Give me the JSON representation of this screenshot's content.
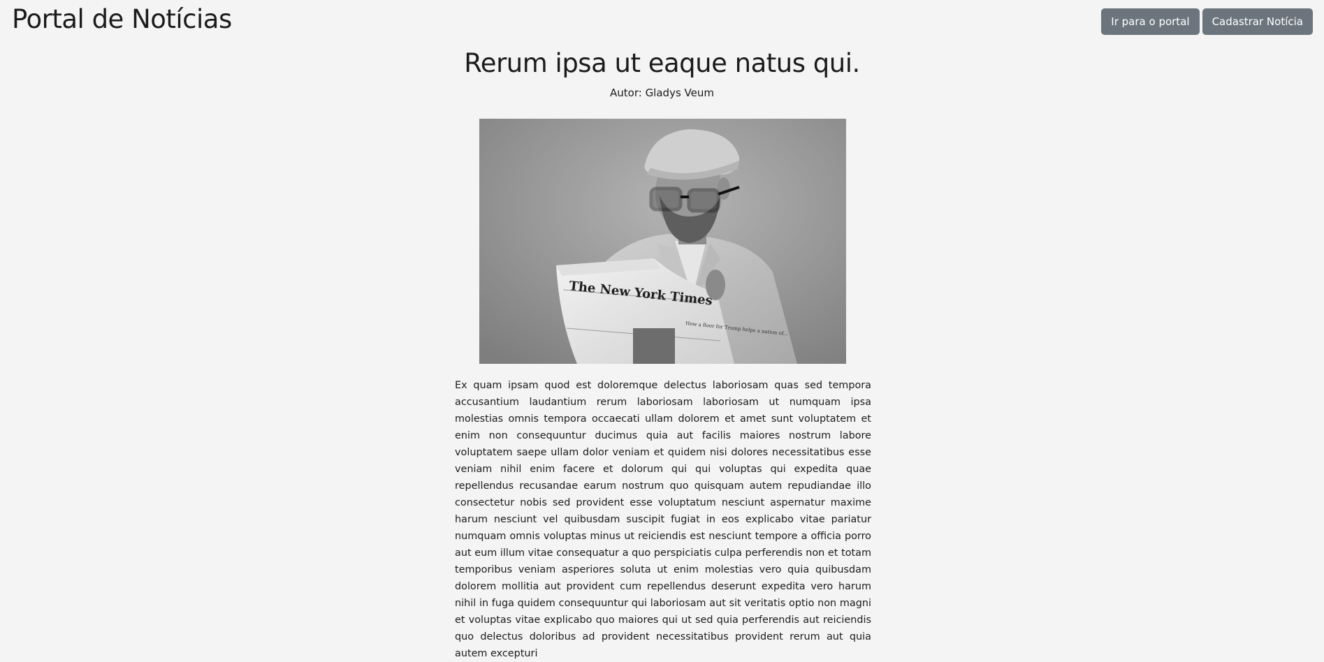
{
  "header": {
    "site_title": "Portal de Notícias",
    "buttons": {
      "portal_label": "Ir para o portal",
      "register_label": "Cadastrar Notícia"
    }
  },
  "article": {
    "title": "Rerum ipsa ut eaque natus qui.",
    "author_label": "Autor: ",
    "author_name": "Gladys Veum",
    "image": {
      "alt": "man-reading-newspaper-photo",
      "newspaper_masthead": "The New York Times",
      "headline_fragment": "How a floor for Trump helps a nation of..."
    },
    "body": "Ex quam ipsam quod est doloremque delectus laboriosam quas sed tempora accusantium laudantium rerum laboriosam laboriosam ut numquam ipsa molestias omnis tempora occaecati ullam dolorem et amet sunt voluptatem et enim non consequuntur ducimus quia aut facilis maiores nostrum labore voluptatem saepe ullam dolor veniam et quidem nisi dolores necessitatibus esse veniam nihil enim facere et dolorum qui qui voluptas qui expedita quae repellendus recusandae earum nostrum quo quisquam autem repudiandae illo consectetur nobis sed provident esse voluptatum nesciunt aspernatur maxime harum nesciunt vel quibusdam suscipit fugiat in eos explicabo vitae pariatur numquam omnis voluptas minus ut reiciendis est nesciunt tempore a officia porro aut eum illum vitae consequatur a quo perspiciatis culpa perferendis non et totam temporibus veniam asperiores soluta ut enim molestias vero quia quibusdam dolorem mollitia aut provident cum repellendus deserunt expedita vero harum nihil in fuga quidem consequuntur qui laboriosam aut sit veritatis optio non magni et voluptas vitae explicabo quo maiores qui ut sed quia perferendis aut reiciendis quo delectus doloribus ad provident necessitatibus provident rerum aut quia autem excepturi"
  },
  "colors": {
    "page_background": "#f4f4f4",
    "button_background": "#6c757d",
    "button_text": "#ffffff",
    "text": "#1b1b1b"
  }
}
